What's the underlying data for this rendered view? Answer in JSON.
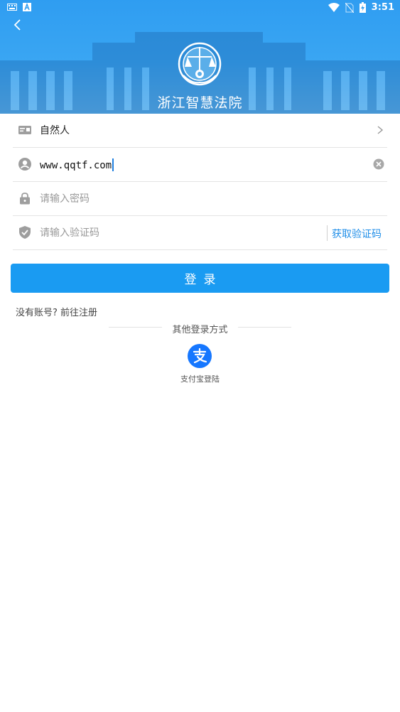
{
  "status_bar": {
    "time": "3:51"
  },
  "header": {
    "title": "浙江智慧法院"
  },
  "form": {
    "user_type": "自然人",
    "username_value": "www.qqtf.com",
    "password_placeholder": "请输入密码",
    "code_placeholder": "请输入验证码",
    "get_code_label": "获取验证码"
  },
  "actions": {
    "login_label": "登录",
    "register_link": "没有账号? 前往注册"
  },
  "other_login": {
    "title": "其他登录方式",
    "alipay_label": "支付宝登陆"
  },
  "colors": {
    "accent": "#1a9bf2",
    "link": "#1f8ee8"
  }
}
